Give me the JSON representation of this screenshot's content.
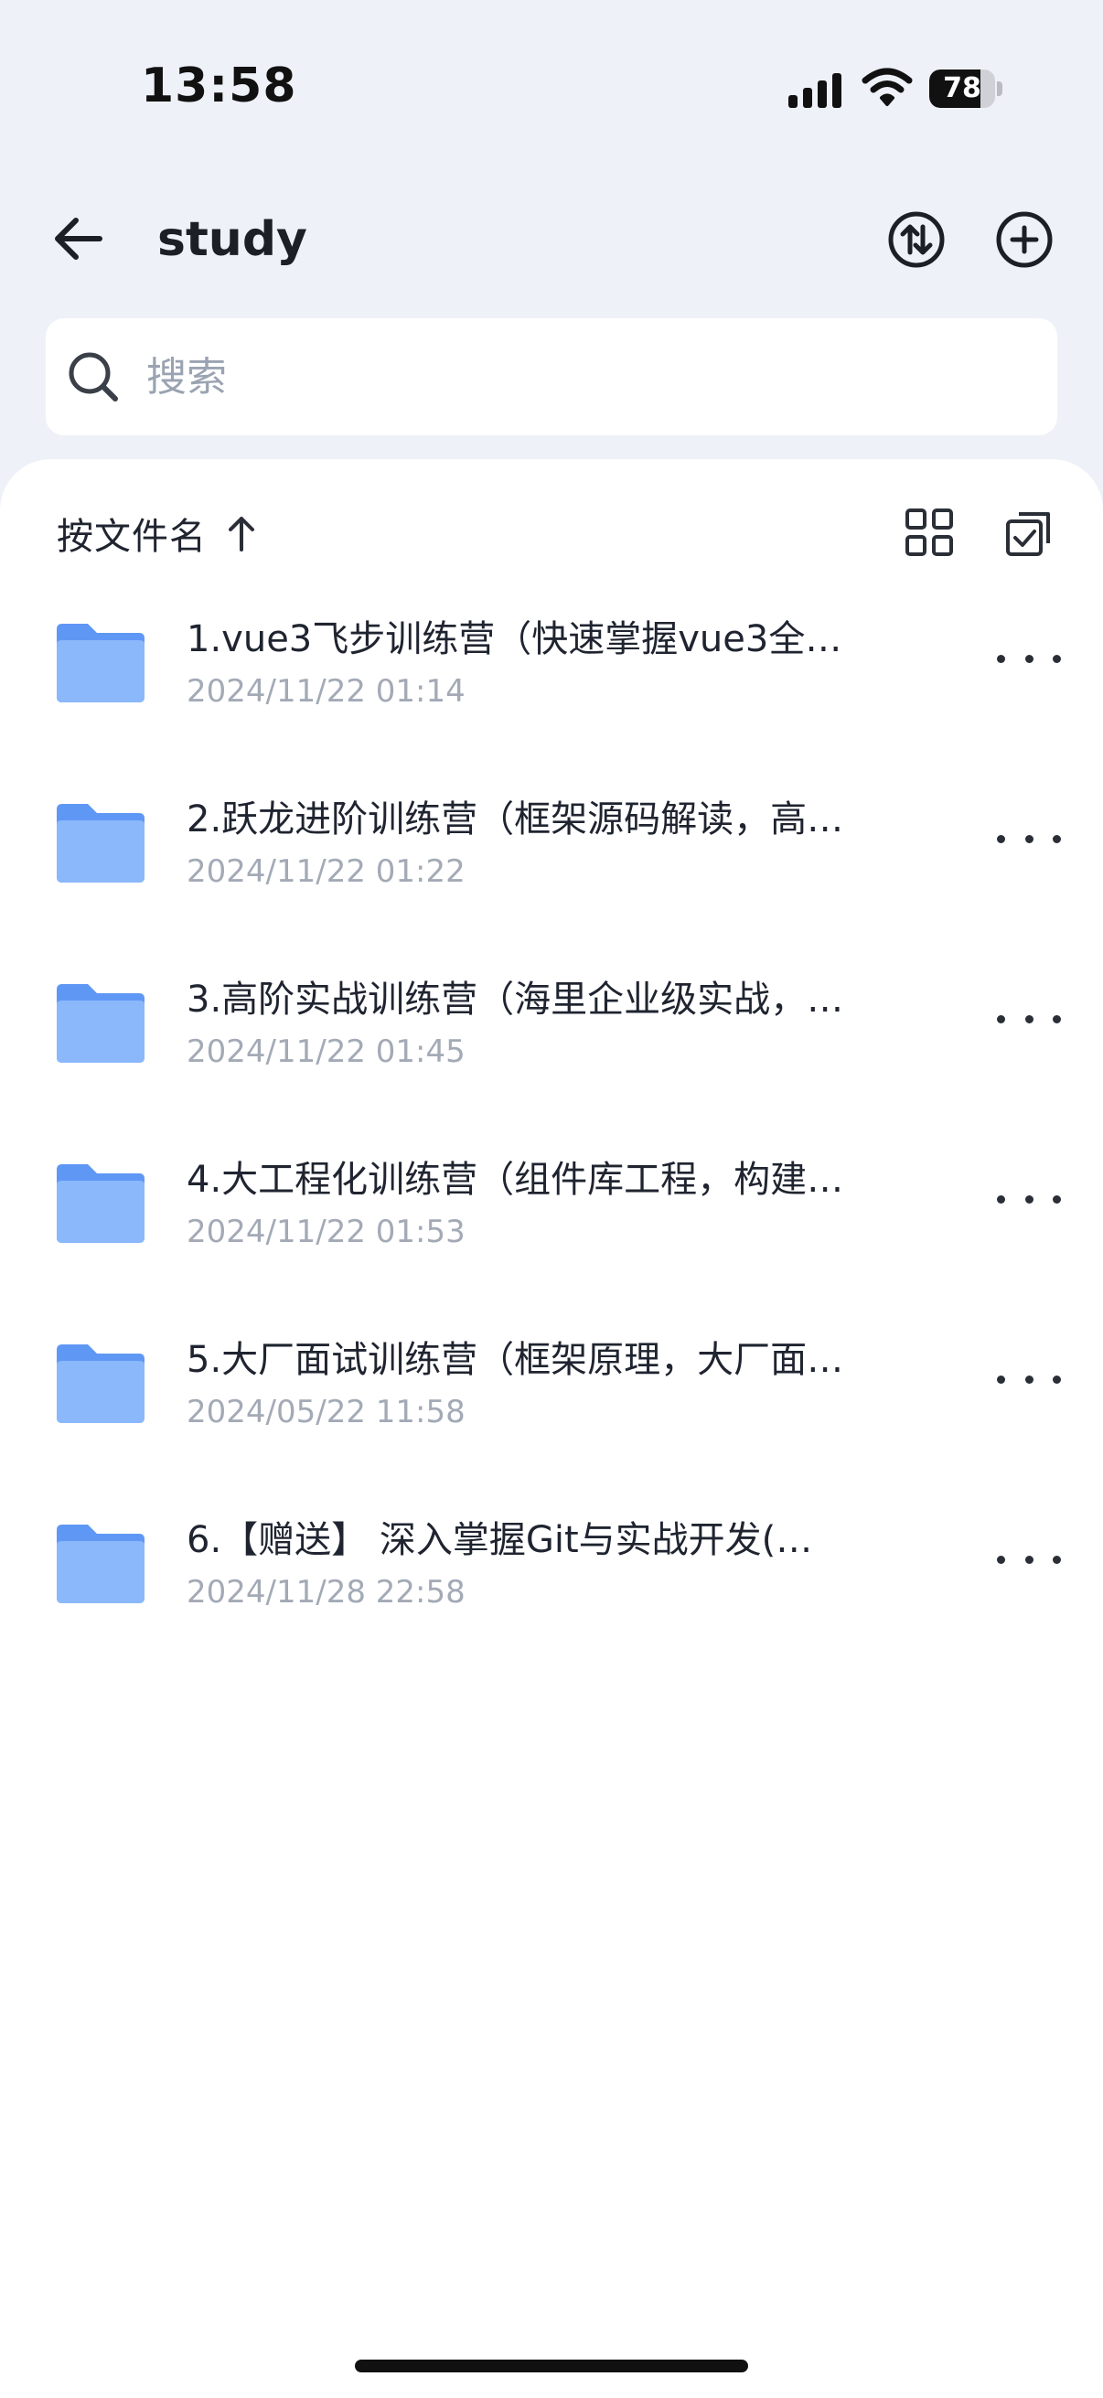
{
  "status_bar": {
    "time": "13:58",
    "battery_level": "78",
    "signal_icon": "signal-bars-icon",
    "wifi_icon": "wifi-icon"
  },
  "nav": {
    "title": "study",
    "back_icon": "arrow-left-icon",
    "transfer_icon": "transfer-arrows-icon",
    "add_icon": "plus-circle-icon"
  },
  "search": {
    "placeholder": "搜索",
    "value": ""
  },
  "toolbar": {
    "sort_label": "按文件名",
    "sort_direction_icon": "arrow-up-icon",
    "grid_view_icon": "grid-icon",
    "multiselect_icon": "multi-select-icon"
  },
  "files": [
    {
      "name": "1.vue3飞步训练营（快速掌握vue3全…",
      "date": "2024/11/22 01:14",
      "icon": "folder-icon"
    },
    {
      "name": "2.跃龙进阶训练营（框架源码解读，高…",
      "date": "2024/11/22 01:22",
      "icon": "folder-icon"
    },
    {
      "name": "3.高阶实战训练营（海里企业级实战，…",
      "date": "2024/11/22 01:45",
      "icon": "folder-icon"
    },
    {
      "name": "4.大工程化训练营（组件库工程，构建…",
      "date": "2024/11/22 01:53",
      "icon": "folder-icon"
    },
    {
      "name": "5.大厂面试训练营（框架原理，大厂面…",
      "date": "2024/05/22 11:58",
      "icon": "folder-icon"
    },
    {
      "name": "6.【赠送】 深入掌握Git与实战开发(…",
      "date": "2024/11/28 22:58",
      "icon": "folder-icon"
    }
  ],
  "colors": {
    "background": "#eef1f8",
    "panel": "#ffffff",
    "folder": "#6ea2f7",
    "secondary_text": "#a3aab6"
  }
}
